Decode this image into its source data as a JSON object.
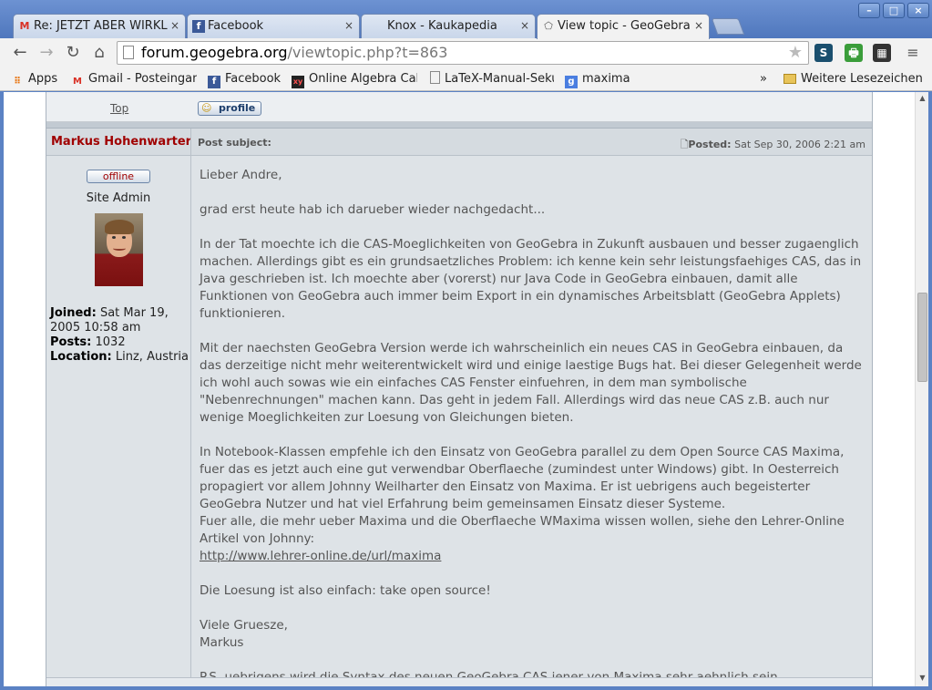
{
  "tabs": [
    {
      "icon": "gmail-icon",
      "label": "Re: JETZT ABER WIRKL",
      "close": "×"
    },
    {
      "icon": "facebook-icon",
      "label": "Facebook",
      "close": "×"
    },
    {
      "icon": "",
      "label": "Knox - Kaukapedia",
      "close": "×"
    },
    {
      "icon": "geogebra-icon",
      "label": "View topic - GeoGebra",
      "close": "×"
    }
  ],
  "window_buttons": {
    "minimize": "–",
    "maximize": "□",
    "close": "×"
  },
  "toolbar": {
    "url_host": "forum.geogebra.org",
    "url_path": "/viewtopic.php?t=863",
    "ext_s": "S",
    "ext_print": "🖶",
    "ext_film": "▦"
  },
  "bookmarks": [
    {
      "icon": "apps-icon",
      "label": "Apps"
    },
    {
      "icon": "gmail-icon",
      "label": "Gmail - Posteingan"
    },
    {
      "icon": "facebook-icon",
      "label": "Facebook"
    },
    {
      "icon": "algebra-icon",
      "label": "Online Algebra Cal"
    },
    {
      "icon": "page-icon",
      "label": "LaTeX-Manual-Seku"
    },
    {
      "icon": "google-icon",
      "label": "maxima"
    }
  ],
  "bookmarks_overflow": "»",
  "bookmarks_other": "Weitere Lesezeichen",
  "prev_post": {
    "top_link": "Top",
    "profile_label": "profile"
  },
  "post": {
    "author": "Markus Hohenwarter",
    "subject_label": "Post subject:",
    "posted_label": "Posted:",
    "posted_date": "Sat Sep 30, 2006 2:21 am",
    "status": "offline",
    "rank": "Site Admin",
    "joined_label": "Joined:",
    "joined_value": "Sat Mar 19, 2005 10:58 am",
    "posts_label": "Posts:",
    "posts_value": "1032",
    "location_label": "Location:",
    "location_value": "Linz, Austria",
    "body": {
      "greeting": "Lieber Andre,",
      "p1": "grad erst heute hab ich darueber wieder nachgedacht...",
      "p2": "In der Tat moechte ich die CAS-Moeglichkeiten von GeoGebra in Zukunft ausbauen und besser zugaenglich machen. Allerdings gibt es ein grundsaetzliches Problem: ich kenne kein sehr leistungsfaehiges CAS, das in Java geschrieben ist. Ich moechte aber (vorerst) nur Java Code in GeoGebra einbauen, damit alle Funktionen von GeoGebra auch immer beim Export in ein dynamisches Arbeitsblatt (GeoGebra Applets) funktionieren.",
      "p3": "Mit der naechsten GeoGebra Version werde ich wahrscheinlich ein neues CAS in GeoGebra einbauen, da das derzeitige nicht mehr weiterentwickelt wird und einige laestige Bugs hat. Bei dieser Gelegenheit werde ich wohl auch sowas wie ein einfaches CAS Fenster einfuehren, in dem man symbolische \"Nebenrechnungen\" machen kann. Das geht in jedem Fall. Allerdings wird das neue CAS z.B. auch nur wenige Moeglichkeiten zur Loesung von Gleichungen bieten.",
      "p4": "In Notebook-Klassen empfehle ich den Einsatz von GeoGebra parallel zu dem Open Source CAS Maxima, fuer das es jetzt auch eine gut verwendbar Oberflaeche (zumindest unter Windows) gibt. In Oesterreich propagiert vor allem Johnny Weilharter den Einsatz von Maxima. Er ist uebrigens auch begeisterter GeoGebra Nutzer und hat viel Erfahrung beim gemeinsamen Einsatz dieser Systeme.",
      "p5": "Fuer alle, die mehr ueber Maxima und die Oberflaeche WMaxima wissen wollen, siehe den Lehrer-Online Artikel von Johnny:",
      "link": "http://www.lehrer-online.de/url/maxima",
      "p6": "Die Loesung ist also einfach: take open source!",
      "closing1": "Viele Gruesze,",
      "closing2": "Markus",
      "ps": "P.S. uebrigens wird die Syntax des neuen GeoGebra CAS jener von Maxima sehr aehnlich sein..."
    }
  }
}
